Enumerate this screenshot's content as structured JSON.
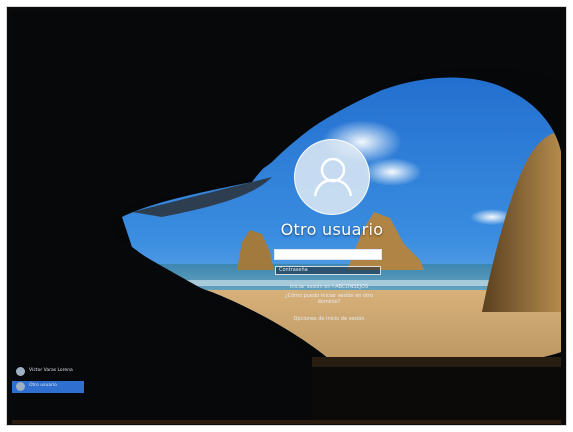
{
  "login": {
    "username": "Otro usuario",
    "password_placeholder": "Contraseña",
    "signin_link": "Iniciar sesión en I-ABCONSEJOS",
    "forgot_link": "¿Cómo puedo iniciar sesión en otro dominio?",
    "options_link": "Opciones de inicio de sesión"
  },
  "users": [
    {
      "name": "Víctor Varas Lorena"
    },
    {
      "name": "Otro usuario"
    }
  ],
  "colors": {
    "sky_top": "#1d6fd6",
    "sky_bottom": "#bfe0f5",
    "sea": "#2a6f95",
    "sand": "#c9a46a",
    "rock": "#8a6a38",
    "selected_user": "#2e6fd0"
  },
  "icons": [
    "user-avatar-icon"
  ]
}
